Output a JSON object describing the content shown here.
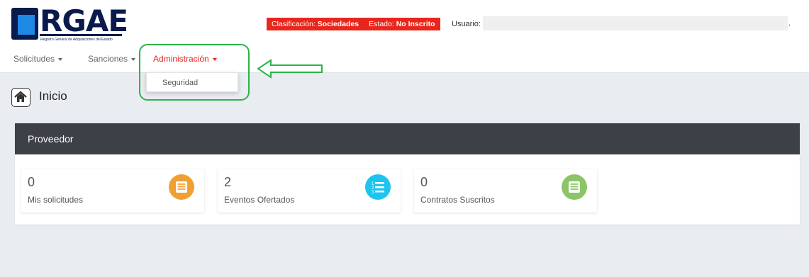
{
  "logo": {
    "text": "RGAE",
    "subtitle": "Registro General de Adquisiciones del Estado"
  },
  "status": {
    "clasificacion_label": "Clasificación:",
    "clasificacion_value": "Sociedades",
    "estado_label": "Estado:",
    "estado_value": "No Inscrito"
  },
  "user": {
    "label": "Usuario:",
    "value": "",
    "trailing": "."
  },
  "nav": {
    "items": [
      {
        "label": "Solicitudes"
      },
      {
        "label": "Sanciones"
      },
      {
        "label": "Administración"
      }
    ]
  },
  "dropdown": {
    "items": [
      {
        "label": "Seguridad"
      }
    ]
  },
  "page": {
    "title": "Inicio"
  },
  "panel": {
    "title": "Proveedor",
    "cards": [
      {
        "count": "0",
        "label": "Mis solicitudes",
        "icon": "document-list-icon",
        "color": "#f0a033"
      },
      {
        "count": "2",
        "label": "Eventos Ofertados",
        "icon": "numbered-list-icon",
        "color": "#1ec4f0"
      },
      {
        "count": "0",
        "label": "Contratos Suscritos",
        "icon": "document-list-icon",
        "color": "#8cc467"
      }
    ]
  },
  "colors": {
    "accent_red": "#e8261c",
    "header_dark": "#3d4147",
    "highlight_green": "#2bb34a"
  }
}
